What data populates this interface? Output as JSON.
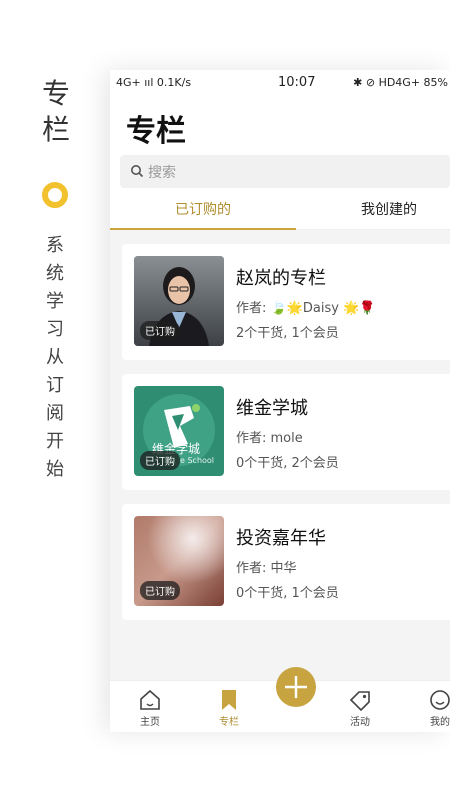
{
  "promo": {
    "title_chars": [
      "专",
      "栏"
    ],
    "subtitle_chars": [
      "系",
      "统",
      "学",
      "习",
      "从",
      "订",
      "阅",
      "开",
      "始"
    ],
    "accent_color": "#f2c12e"
  },
  "status_bar": {
    "left": "4G+ ııl  0.1K/s",
    "time": "10:07",
    "right": "✱ ⊘ HD4G+ 85%"
  },
  "header": {
    "title": "专栏"
  },
  "search": {
    "placeholder": "搜索"
  },
  "tabs": [
    {
      "label": "已订购的",
      "active": true
    },
    {
      "label": "我创建的",
      "active": false
    }
  ],
  "columns": [
    {
      "title": "赵岚的专栏",
      "author": "作者: 🍃🌟Daisy 🌟🌹",
      "stats": "2个干货, 1个会员",
      "badge": "已订购",
      "thumb_icon": "portrait-photo"
    },
    {
      "title": "维金学城",
      "author": "作者: mole",
      "stats": "0个干货, 2个会员",
      "badge": "已订购",
      "thumb_icon": "school-logo",
      "thumb_caption": "维金学城",
      "thumb_caption_en": "e School"
    },
    {
      "title": "投资嘉年华",
      "author": "作者: 中华",
      "stats": "0个干货, 1个会员",
      "badge": "已订购",
      "thumb_icon": "blurred-photo"
    }
  ],
  "tabbar": [
    {
      "label": "主页",
      "icon": "home-icon",
      "active": false
    },
    {
      "label": "专栏",
      "icon": "bookmark-icon",
      "active": true
    },
    {
      "label": "",
      "icon": "plus-icon",
      "active": false
    },
    {
      "label": "活动",
      "icon": "tag-icon",
      "active": false
    },
    {
      "label": "我的",
      "icon": "smile-icon",
      "active": false
    }
  ],
  "colors": {
    "gold": "#c8a440",
    "gold_text": "#b08d2e",
    "background": "#f4f4f4"
  }
}
